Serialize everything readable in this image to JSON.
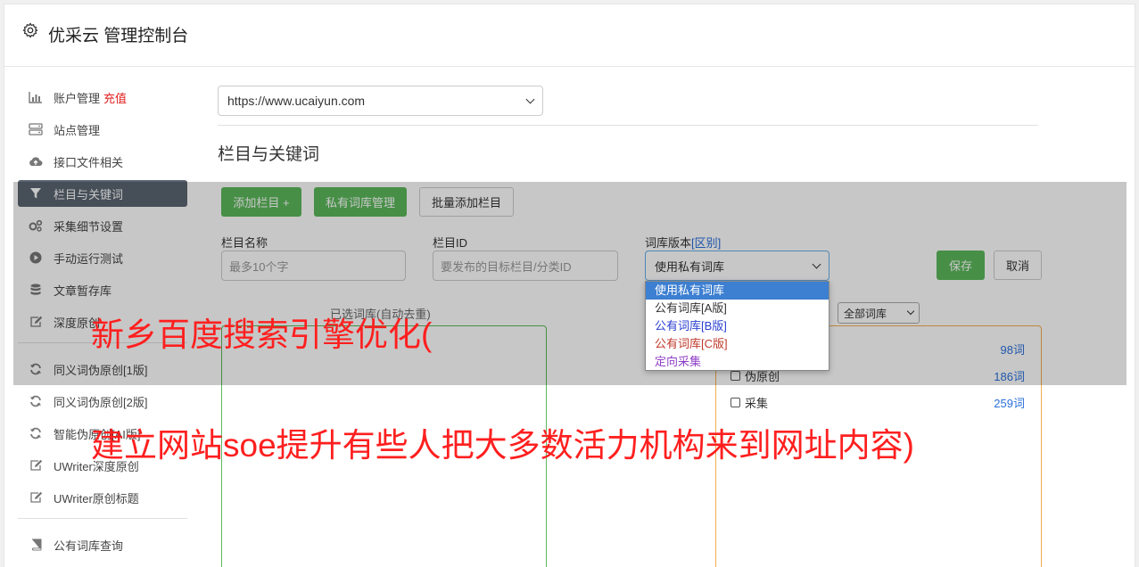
{
  "header": {
    "title": "优采云 管理控制台",
    "icon": "gear-icon"
  },
  "sidebar": {
    "items": [
      {
        "label": "账户管理",
        "extra": "充值",
        "icon": "bar-chart-icon"
      },
      {
        "label": "站点管理",
        "icon": "server-icon"
      },
      {
        "label": "接口文件相关",
        "icon": "cloud-upload-icon"
      },
      {
        "label": "栏目与关键词",
        "icon": "filter-icon",
        "active": true
      },
      {
        "label": "采集细节设置",
        "icon": "cogs-icon"
      },
      {
        "label": "手动运行测试",
        "icon": "play-circle-icon"
      },
      {
        "label": "文章暂存库",
        "icon": "database-icon"
      },
      {
        "label": "深度原创",
        "icon": "edit-icon"
      }
    ],
    "items2": [
      {
        "label": "同义词伪原创[1版]",
        "icon": "refresh-icon"
      },
      {
        "label": "同义词伪原创[2版]",
        "icon": "refresh-icon"
      },
      {
        "label": "智能伪原创[AI版]",
        "icon": "refresh-icon"
      },
      {
        "label": "UWriter深度原创",
        "icon": "edit-icon"
      },
      {
        "label": "UWriter原创标题",
        "icon": "edit-icon"
      }
    ],
    "items3": [
      {
        "label": "公有词库查询",
        "icon": "book-icon"
      }
    ]
  },
  "main": {
    "site_select": "https://www.ucaiyun.com",
    "section_title": "栏目与关键词",
    "buttons": {
      "add_column": "添加栏目 +",
      "private_lib": "私有词库管理",
      "batch_add": "批量添加栏目",
      "save": "保存",
      "cancel": "取消"
    },
    "form": {
      "name_label": "栏目名称",
      "name_placeholder": "最多10个字",
      "id_label": "栏目ID",
      "id_placeholder": "要发布的目标栏目/分类ID",
      "version_label": "词库版本",
      "version_link": "[区别]",
      "version_value": "使用私有词库"
    },
    "dropdown": [
      {
        "label": "使用私有词库",
        "color": "#ffffff",
        "selected": true
      },
      {
        "label": "公有词库[A版]",
        "color": "#333333"
      },
      {
        "label": "公有词库[B版]",
        "color": "#2a3fd0"
      },
      {
        "label": "公有词库[C版]",
        "color": "#c0392b"
      },
      {
        "label": "定向采集",
        "color": "#8e3fc7"
      }
    ],
    "left_panel_head": "已选词库(自动去重)",
    "right_filter": "全部词库",
    "libs": [
      {
        "label": "",
        "count": "98词"
      },
      {
        "label": "伪原创",
        "count": "186词"
      },
      {
        "label": "采集",
        "count": "259词"
      }
    ]
  },
  "watermark": {
    "line1": "新乡百度搜索引擎优化(",
    "line2": "建立网站soe提升有些人把大多数活力机构来到网址内容)"
  }
}
